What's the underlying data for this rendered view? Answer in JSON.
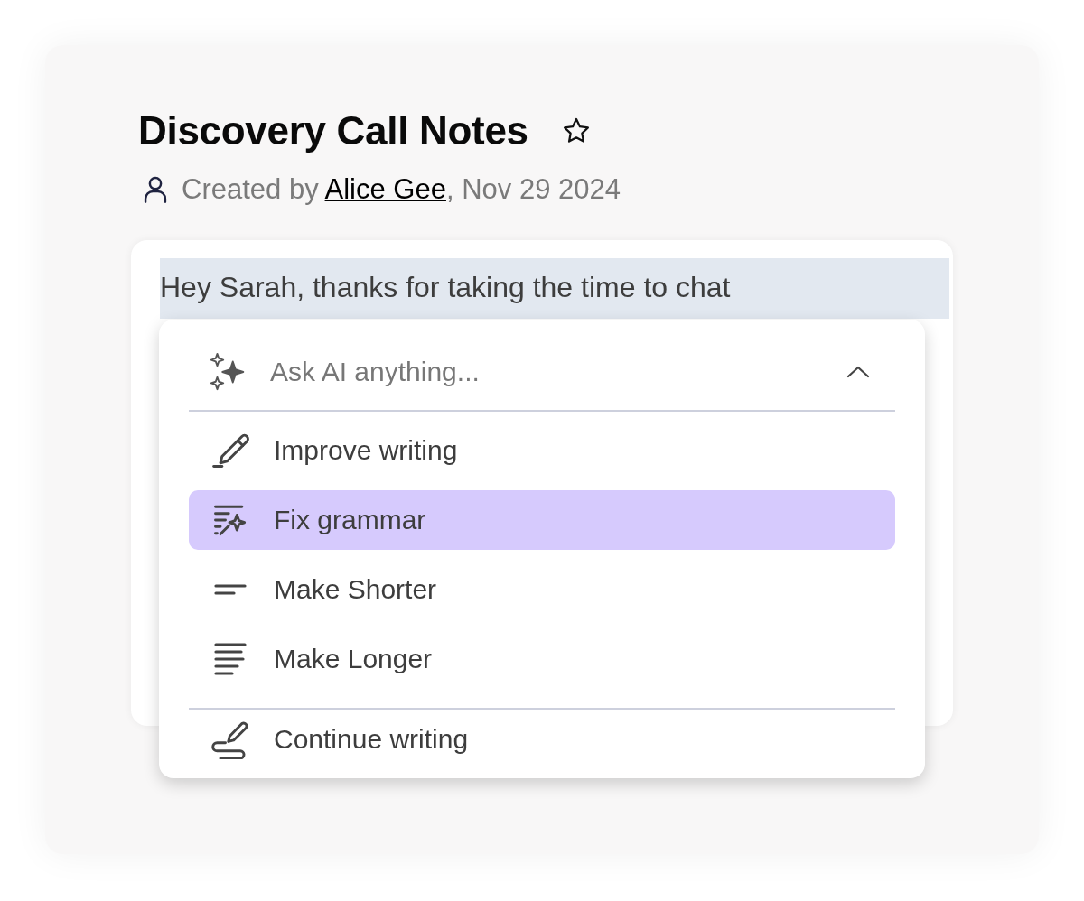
{
  "note": {
    "title": "Discovery Call Notes",
    "starred": false,
    "created_prefix": "Created by",
    "author": "Alice Gee",
    "created_suffix": ", Nov 29 2024"
  },
  "editor": {
    "selected_text": "Hey Sarah, thanks for taking the time to chat"
  },
  "ai_menu": {
    "placeholder": "Ask AI anything...",
    "expanded": true,
    "sections": [
      {
        "items": [
          {
            "kind": "improve",
            "label": "Improve writing",
            "selected": false
          },
          {
            "kind": "grammar",
            "label": "Fix grammar",
            "selected": true
          },
          {
            "kind": "shorter",
            "label": "Make Shorter",
            "selected": false
          },
          {
            "kind": "longer",
            "label": "Make Longer",
            "selected": false
          }
        ]
      },
      {
        "items": [
          {
            "kind": "continue",
            "label": "Continue writing",
            "selected": false
          }
        ]
      }
    ]
  }
}
